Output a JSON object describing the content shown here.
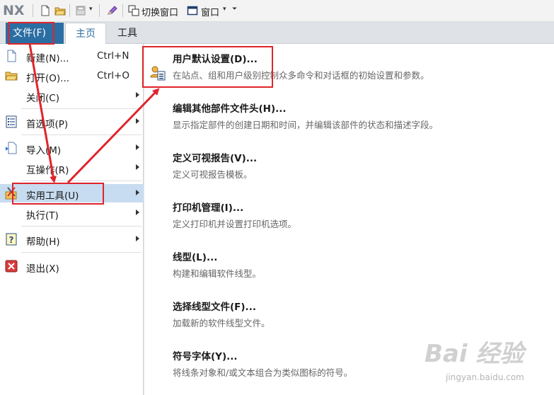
{
  "app": {
    "logo": "NX"
  },
  "toolbar": {
    "switch_window": "切换窗口",
    "window": "窗口"
  },
  "tabs": {
    "file": "文件(F)",
    "home": "主页",
    "tools": "工具"
  },
  "file_menu": {
    "items": [
      {
        "label": "新建(N)...",
        "shortcut": "Ctrl+N",
        "icon": "new-file-icon"
      },
      {
        "label": "打开(O)...",
        "shortcut": "Ctrl+O",
        "icon": "open-folder-icon"
      },
      {
        "label": "关闭(C)",
        "shortcut": "",
        "icon": ""
      },
      {
        "label": "首选项(P)",
        "shortcut": "",
        "icon": "preferences-icon"
      },
      {
        "label": "导入(M)",
        "shortcut": "",
        "icon": "import-icon"
      },
      {
        "label": "互操作(R)",
        "shortcut": "",
        "icon": ""
      },
      {
        "label": "实用工具(U)",
        "shortcut": "",
        "icon": "utilities-icon"
      },
      {
        "label": "执行(T)",
        "shortcut": "",
        "icon": ""
      },
      {
        "label": "帮助(H)",
        "shortcut": "",
        "icon": "help-icon"
      },
      {
        "label": "退出(X)",
        "shortcut": "",
        "icon": "exit-icon"
      }
    ]
  },
  "submenu": {
    "items": [
      {
        "title": "用户默认设置(D)...",
        "desc": "在站点、组和用户级别控制众多命令和对话框的初始设置和参数。"
      },
      {
        "title": "编辑其他部件文件头(H)...",
        "desc": "显示指定部件的创建日期和时间，并编辑该部件的状态和描述字段。"
      },
      {
        "title": "定义可视报告(V)...",
        "desc": "定义可视报告模板。"
      },
      {
        "title": "打印机管理(I)...",
        "desc": "定义打印机并设置打印机选项。"
      },
      {
        "title": "线型(L)...",
        "desc": "构建和编辑软件线型。"
      },
      {
        "title": "选择线型文件(F)...",
        "desc": "加载新的软件线型文件。"
      },
      {
        "title": "符号字体(Y)...",
        "desc": "将线条对象和/或文本组合为类似图标的符号。"
      }
    ]
  },
  "watermark": {
    "brand": "Bai 经验",
    "site": "jingyan.baidu.com"
  },
  "colors": {
    "accent": "#2b6ea3",
    "highlight": "#c7dcf0",
    "annotation": "#e0242b"
  }
}
